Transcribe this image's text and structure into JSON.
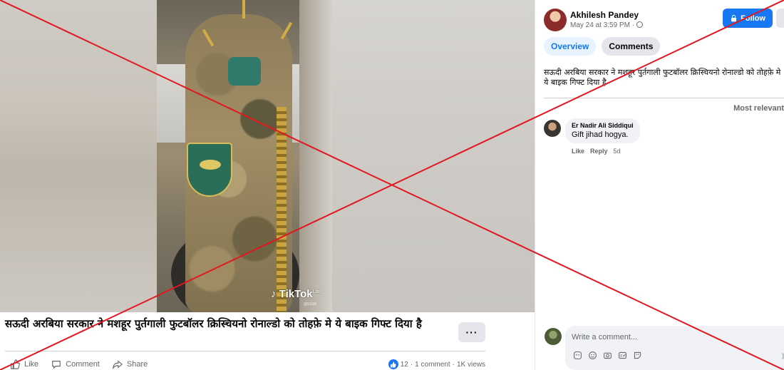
{
  "video": {
    "watermark": "TikTok",
    "watermark_suffix": "Lite",
    "watermark_handle": "@r2sd"
  },
  "post": {
    "title": "सऊदी अरबिया सरकार ने मशहूर पुर्तगाली फुटबॉलर क्रिस्चियनो रोनाल्डो को तोहफ़े मे ये बाइक गिफ्ट दिया है",
    "more_label": "···",
    "actions": {
      "like": "Like",
      "comment": "Comment",
      "share": "Share"
    },
    "stats": {
      "reactions": "12",
      "comments": "1 comment",
      "views": "1K views",
      "separator": "·"
    }
  },
  "panel": {
    "author": "Akhilesh Pandey",
    "time": "May 24 at 3:59 PM · ",
    "follow_label": "Follow",
    "tabs": [
      {
        "label": "Overview",
        "active": true
      },
      {
        "label": "Comments",
        "active": false
      }
    ],
    "text": "सऊदी अरबिया सरकार ने मशहूर पुर्तगाली फुटबॉलर क्रिस्चियनो रोनाल्डो को तोहफ़े मे ये बाइक गिफ्ट दिया है",
    "sort_label": "Most relevant",
    "comments": [
      {
        "author": "Er Nadir Ali Siddiqui",
        "text": "Gift jihad hogya.",
        "like": "Like",
        "reply": "Reply",
        "age": "5d"
      }
    ],
    "composer_placeholder": "Write a comment..."
  },
  "colors": {
    "accent": "#1877f2",
    "overlay_x": "#e0181f"
  },
  "icons": [
    "globe-icon",
    "lock-icon",
    "like-icon",
    "comment-icon",
    "share-icon",
    "like-reaction-icon",
    "sticker-icon",
    "emoji-icon",
    "camera-icon",
    "gif-icon",
    "avatar-sticker-icon",
    "send-icon"
  ]
}
